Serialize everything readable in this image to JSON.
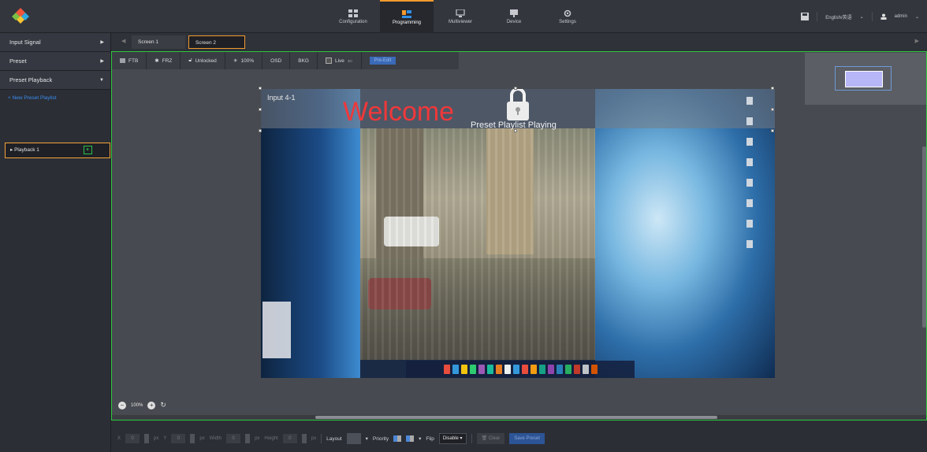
{
  "nav": {
    "items": [
      {
        "label": "Configuration",
        "icon": "grid-icon"
      },
      {
        "label": "Programming",
        "icon": "programming-icon",
        "active": true
      },
      {
        "label": "Multiviewer",
        "icon": "monitor-icon"
      },
      {
        "label": "Device",
        "icon": "device-icon"
      },
      {
        "label": "Settings",
        "icon": "gear-icon"
      }
    ],
    "language": "English/英语",
    "user": "admin"
  },
  "sidebar": {
    "sections": [
      {
        "label": "Input Signal",
        "icon": "chevron-right-icon"
      },
      {
        "label": "Preset",
        "icon": "chevron-right-icon"
      },
      {
        "label": "Preset Playback",
        "icon": "chevron-down-icon"
      }
    ],
    "new_playlist": "New Preset Playlist",
    "playlist_item": "Playback 1"
  },
  "screens": {
    "tabs": [
      "Screen 1",
      "Screen 2"
    ],
    "active": "Screen 2"
  },
  "toolbar": {
    "ftb": "FTB",
    "frz": "FRZ",
    "lock": "Unlocked",
    "brightness": "100%",
    "osd": "OSD",
    "bkg": "BKG",
    "live": "Live",
    "pre_edit": "Pre-Edit"
  },
  "canvas": {
    "input_label": "Input 4-1",
    "welcome": "Welcome",
    "status": "Preset Playlist Playing"
  },
  "zoom": {
    "level": "100%"
  },
  "properties": {
    "x_label": "X",
    "x_value": "0",
    "y_label": "Y",
    "y_value": "0",
    "width_label": "Width",
    "width_value": "0",
    "height_label": "Height",
    "height_value": "0",
    "unit": "px",
    "layout_label": "Layout",
    "priority_label": "Priority",
    "flip_label": "Flip",
    "flip_value": "Disable",
    "clear_label": "Clear",
    "save_label": "Save Preset"
  },
  "colors": {
    "accent_orange": "#f39a2e",
    "border_green": "#2fc83f",
    "link_blue": "#3a8ef0",
    "welcome_red": "#f0383a"
  }
}
